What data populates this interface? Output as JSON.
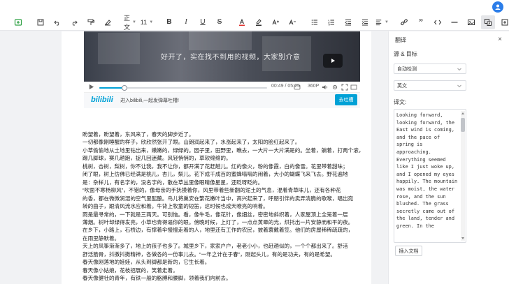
{
  "toolbar": {
    "paragraph_style": "正文",
    "font_size": "11"
  },
  "video": {
    "caption": "好开了，实在找不到用的视频，大家别介意",
    "time": "00:49 / 05:25",
    "quality": "360P",
    "progress": 0.15,
    "bili_logo": "bilibili",
    "bili_text": "进入bilibili,一起发弹幕吐槽!",
    "bili_button": "去吐槽"
  },
  "article": {
    "paragraphs": [
      "盼望着，盼望着，东风来了，春天的脚步近了。",
      "一切都像刚睡醒的样子，欣欣然张开了眼。山朗润起来了，水涨起来了，太阳的脸红起来了。",
      "小草偷偷地从土地里钻出来，嫩嫩的，绿绿的。园子里，田野里，瞧去，一大片一大片满是的。坐着，躺着，打两个滚，",
      "踢几脚球，赛几趟跑，捉几回迷藏。风轻悄悄的，草软绵绵的。",
      "桃树，杏树，梨树，你不让我，我不让你，都开满了花赶趟儿。红的像火，粉的像霞，白的像雪。花里带着甜味；",
      "闭了眼，树上仿佛已经满是桃儿，杏儿，梨儿。花下成千成百的蜜蜂嗡嗡的闹着，大小的蝴蝶飞来飞去。野花遍地",
      "是：杂样儿，有名字的，没名字的，散在草丛里像眼睛像星星，还眨呀眨的。",
      "“吹面不寒杨柳风”，不错的，像母亲的手抚摸着你，风里带着些新翻的泥土的气息，混着青草味儿，还有各种花",
      "的香，都在微微润湿的空气里酝酿。鸟儿将巢安在繁花嫩叶当中，高兴起来了，呼朋引伴的卖弄清脆的歌喉，唱出宛",
      "转的曲子，跟清风流水应和着。牛背上牧童的短笛，这时候也成天嘹亮的响着。",
      "雨是最寻常的，一下就是三两天。可别恼。看，像牛毛，像花针，像细丝，密密地斜织着，人家屋顶上全笼着一层",
      "薄烟。树叶却绿得发亮，小草也青得逼你的眼。傍晚时候，上灯了，一点点黄晕的光，烘托出一片安静而和平的夜。",
      "在乡下，小路上，石桥边，有撑着伞慢慢走着的人，地里还有工作的农民，披着蓑戴着笠。他们的房屋稀稀疏疏的，",
      "在雨里静默着。",
      "天上的风筝渐渐多了，地上的孩子也多了。城里乡下，家家户户，老老小小，也赶趟似的，一个个都出来了。舒活",
      "舒活筋骨，抖擞抖擞精神，各做各的一份事儿去。“一年之计在于春”，刚起头儿，有的是功夫，有的是希望。",
      "春天像刚落地的娃娃，从头到脚都是新的，它生长着。",
      "春天像小姑娘，花枝招展的，笑着走着。",
      "春天像健壮的青年，有铁一般的胳膊和腰脚，领着我们向前去。"
    ]
  },
  "panel": {
    "title": "翻译",
    "close": "×",
    "lang_label": "源 & 目标",
    "source_lang": "自动检测",
    "target_lang": "英文",
    "translation_label": "译文:",
    "translation": "Looking forward, looking forward, the East wind is coming, and the pace of spring is approaching. Everything seemed like I just woke up, and I opened my eyes happily. The mountain was moist, the water rose, and the sun blushed. The grass secretly came out of the land, tender and green. In the",
    "insert_button": "插入文档"
  },
  "colors": {
    "accent": "#00a1d6",
    "avatar": "#2b7de9",
    "font_color_bar": "#e0322f"
  }
}
